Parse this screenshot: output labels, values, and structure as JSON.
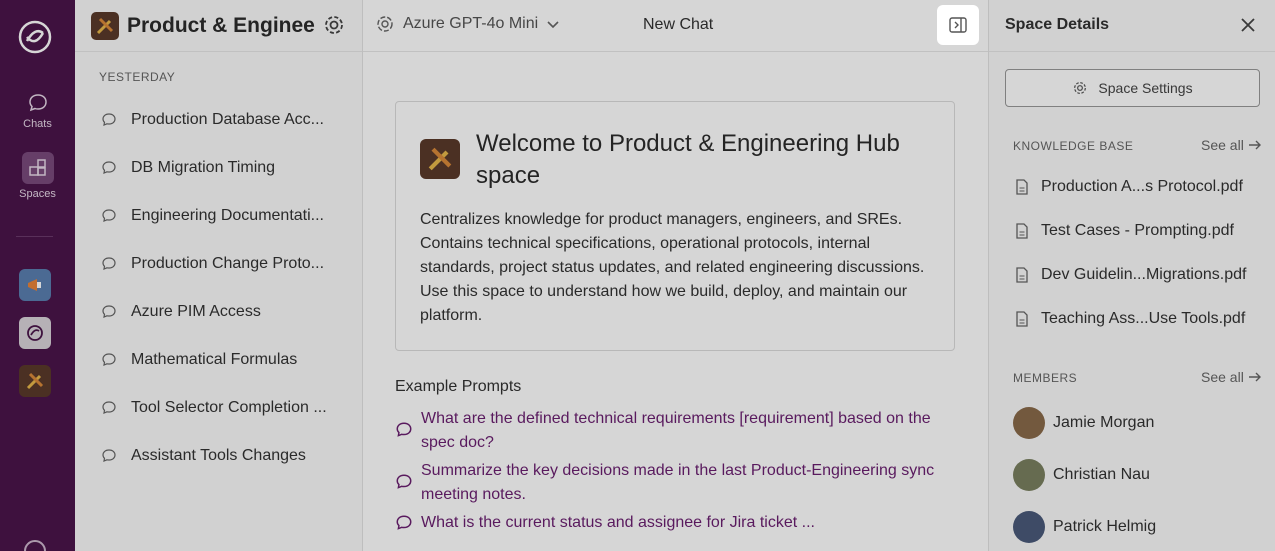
{
  "rail": {
    "items": [
      {
        "label": "Chats",
        "icon": "chat-bubble-icon"
      },
      {
        "label": "Spaces",
        "icon": "grid-icon",
        "active": true
      }
    ],
    "spaces": [
      {
        "icon": "megaphone-icon",
        "color": "#5a7fb0"
      },
      {
        "icon": "logo-icon",
        "color": "#d9d3d9"
      },
      {
        "icon": "pencil-ruler-icon",
        "color": "#5a3a2a"
      }
    ]
  },
  "left": {
    "space_title": "Product & Enginee...",
    "section": "YESTERDAY",
    "conversations": [
      "Production Database Acc...",
      "DB Migration Timing",
      "Engineering Documentati...",
      "Production Change Proto...",
      "Azure PIM Access",
      "Mathematical Formulas",
      "Tool Selector Completion ...",
      "Assistant Tools Changes"
    ]
  },
  "main": {
    "model": "Azure GPT-4o Mini",
    "chat_title": "New Chat",
    "welcome_title": "Welcome to Product & Engineering Hub space",
    "welcome_desc": "Centralizes knowledge for product managers, engineers, and SREs. Contains technical specifications, operational protocols, internal standards, project status updates, and related engineering discussions. Use this space to understand how we build, deploy, and maintain our platform.",
    "prompts_label": "Example Prompts",
    "prompts": [
      "What are the defined technical requirements [requirement] based on the spec doc?",
      "Summarize the key decisions made in the last Product-Engineering sync meeting notes.",
      "What is the current status and assignee for Jira ticket ..."
    ]
  },
  "right": {
    "title": "Space Details",
    "settings_label": "Space Settings",
    "kb_label": "KNOWLEDGE BASE",
    "see_all": "See all",
    "files": [
      "Production A...s Protocol.pdf",
      "Test Cases - Prompting.pdf",
      "Dev Guidelin...Migrations.pdf",
      "Teaching Ass...Use Tools.pdf"
    ],
    "members_label": "MEMBERS",
    "members": [
      {
        "name": "Jamie Morgan",
        "color": "#8a6a4a"
      },
      {
        "name": "Christian Nau",
        "color": "#7a8060"
      },
      {
        "name": "Patrick Helmig",
        "color": "#4a5a7a"
      }
    ]
  },
  "colors": {
    "rail_bg": "#4a154b",
    "accent": "#6b1f70"
  }
}
